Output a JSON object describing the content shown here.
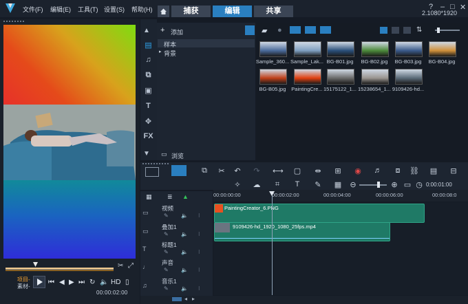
{
  "menubar": {
    "items": [
      {
        "label": "文件(F)",
        "key": "file"
      },
      {
        "label": "编辑(E)",
        "key": "edit"
      },
      {
        "label": "工具(T)",
        "key": "tools"
      },
      {
        "label": "设置(S)",
        "key": "settings"
      },
      {
        "label": "帮助(H)",
        "key": "help"
      }
    ],
    "window_controls": [
      "?",
      "–",
      "□",
      "✕"
    ],
    "resolution": "2.1080*1920"
  },
  "tabs": [
    {
      "label": "捕获",
      "active": false
    },
    {
      "label": "编辑",
      "active": true
    },
    {
      "label": "共享",
      "active": false
    }
  ],
  "preview": {
    "project_label": "项目-",
    "clip_label": "素材-",
    "timecode": "00:00:02:00",
    "hd_label": "HD"
  },
  "library": {
    "add_label": "添加",
    "folders": [
      {
        "label": "样本",
        "selected": true
      },
      {
        "label": "背景",
        "selected": false
      }
    ],
    "browse_label": "浏览",
    "side_icons": [
      "media-icon",
      "audio-icon",
      "transition-icon",
      "title-frame-icon",
      "text-icon",
      "graphics-icon",
      "fx-icon"
    ],
    "fx_text": "FX",
    "t_text": "T",
    "items": [
      {
        "label": "Sample_360...",
        "thumb": "#4a6a9a"
      },
      {
        "label": "Sample_Lak...",
        "thumb": "#7f9fc0"
      },
      {
        "label": "BG-B01.jpg",
        "thumb": "#2a4f7a"
      },
      {
        "label": "BG-B02.jpg",
        "thumb": "#4c8a3a"
      },
      {
        "label": "BG-B03.jpg",
        "thumb": "#3a5a8a"
      },
      {
        "label": "BG-B04.jpg",
        "thumb": "#d0903a"
      },
      {
        "label": "BG-B05.jpg",
        "thumb": "#c0401a"
      },
      {
        "label": "PaintingCre...",
        "thumb": "#e04010"
      },
      {
        "label": "15175122_1...",
        "thumb": "#6a6a6a"
      },
      {
        "label": "15238654_1...",
        "thumb": "#9a9590"
      },
      {
        "label": "9109426-hd...",
        "thumb": "#5a6a78"
      }
    ]
  },
  "timeline": {
    "timecode": "0:00:01:00",
    "ruler_ticks": [
      "00:00:00:00",
      "00:00:02:00",
      "00:00:04:00",
      "00:00:06:00",
      "00:00:08:0"
    ],
    "tracks": [
      {
        "label": "视频",
        "clip": "PaintingCreator_6.PNG"
      },
      {
        "label": "叠加1",
        "clip": "9109426-hd_1920_1080_25fps.mp4"
      },
      {
        "label": "标题1",
        "clip": ""
      },
      {
        "label": "声音",
        "clip": ""
      },
      {
        "label": "音乐1",
        "clip": ""
      }
    ],
    "video_clip_label": "PaintingCreator_6.PNG"
  }
}
